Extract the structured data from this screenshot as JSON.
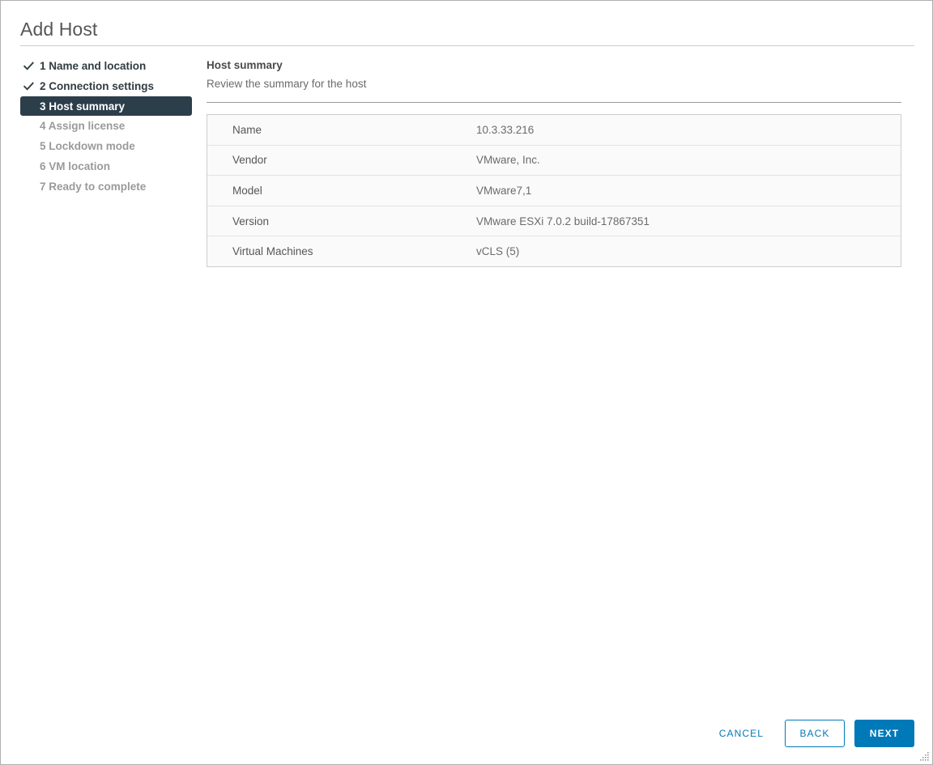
{
  "window": {
    "title": "Add Host",
    "resize_grip_icon": "resize-grip-icon"
  },
  "steps": [
    {
      "label": "1 Name and location",
      "state": "done"
    },
    {
      "label": "2 Connection settings",
      "state": "done"
    },
    {
      "label": "3 Host summary",
      "state": "active"
    },
    {
      "label": "4 Assign license",
      "state": "pending"
    },
    {
      "label": "5 Lockdown mode",
      "state": "pending"
    },
    {
      "label": "6 VM location",
      "state": "pending"
    },
    {
      "label": "7 Ready to complete",
      "state": "pending"
    }
  ],
  "content": {
    "heading": "Host summary",
    "subheading": "Review the summary for the host",
    "rows": [
      {
        "label": "Name",
        "value": "10.3.33.216"
      },
      {
        "label": "Vendor",
        "value": "VMware, Inc."
      },
      {
        "label": "Model",
        "value": "VMware7,1"
      },
      {
        "label": "Version",
        "value": "VMware ESXi 7.0.2 build-17867351"
      },
      {
        "label": "Virtual Machines",
        "value": "vCLS (5)"
      }
    ]
  },
  "footer": {
    "cancel_label": "CANCEL",
    "back_label": "BACK",
    "next_label": "NEXT"
  },
  "colors": {
    "accent_blue": "#0079b8",
    "active_step_bg": "#2d3e4b",
    "checkmark": "#313c42",
    "pending_step_text": "#9a9a9a",
    "table_row_bg": "#fafafa",
    "table_border": "#cdcdcd"
  }
}
